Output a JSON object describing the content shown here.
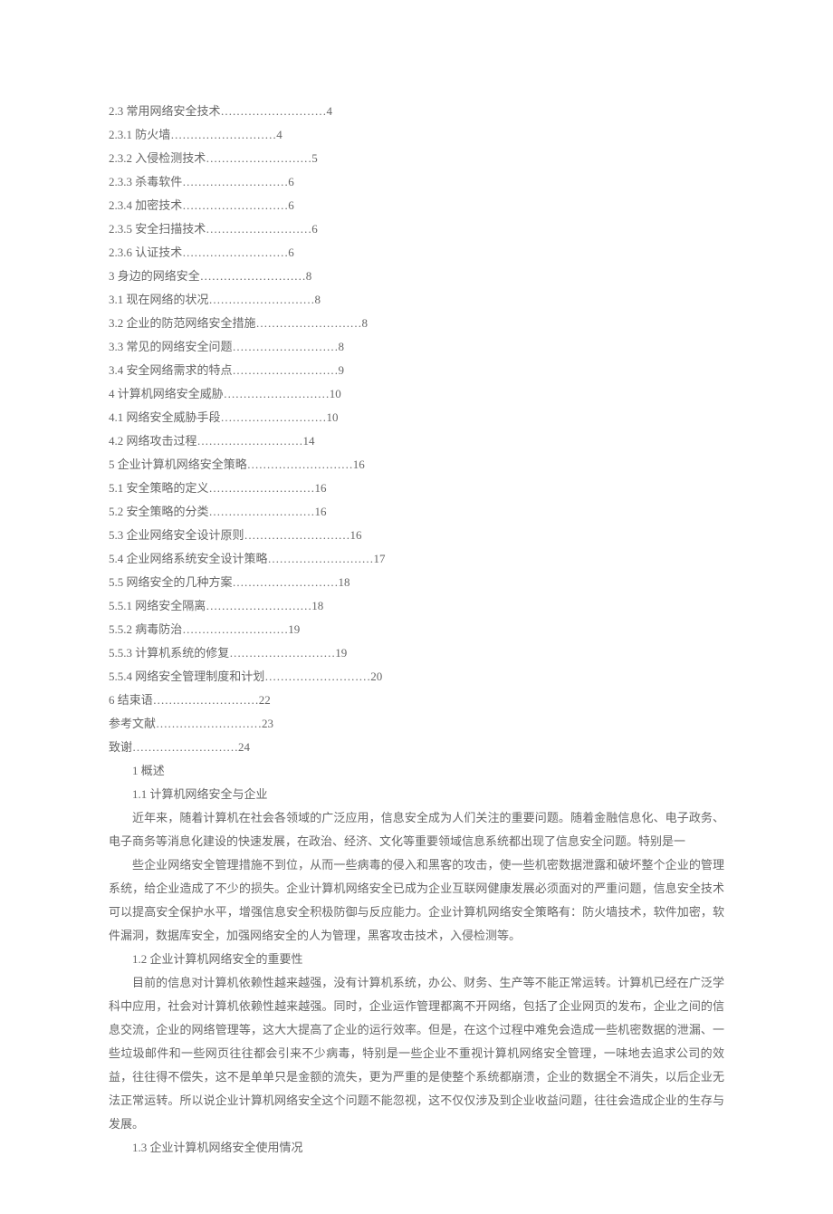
{
  "toc": [
    "2.3 常用网络安全技术………………………4",
    "2.3.1 防火墙………………………4",
    "2.3.2  入侵检测技术………………………5",
    "2.3.3 杀毒软件………………………6",
    "2.3.4 加密技术………………………6",
    "2.3.5 安全扫描技术………………………6",
    "2.3.6 认证技术………………………6",
    "3 身边的网络安全………………………8",
    "3.1 现在网络的状况………………………8",
    "3.2 企业的防范网络安全措施………………………8",
    "3.3 常见的网络安全问题………………………8",
    "3.4  安全网络需求的特点………………………9",
    "4  计算机网络安全威胁………………………10",
    "4.1  网络安全威胁手段………………………10",
    "4.2  网络攻击过程………………………14",
    "5  企业计算机网络安全策略………………………16",
    "5.1  安全策略的定义………………………16",
    "5.2 安全策略的分类………………………16",
    "5.3 企业网络安全设计原则………………………16",
    "5.4 企业网络系统安全设计策略………………………17",
    "5.5 网络安全的几种方案………………………18",
    "5.5.1 网络安全隔离………………………18",
    "5.5.2  病毒防治………………………19",
    "5.5.3  计算机系统的修复………………………19",
    "5.5.4  网络安全管理制度和计划………………………20",
    "6  结束语………………………22",
    "参考文献………………………23",
    "致谢………………………24"
  ],
  "h1": "1  概述",
  "h11": "1.1 计算机网络安全与企业",
  "p11a": "近年来，随着计算机在社会各领域的广泛应用，信息安全成为人们关注的重要问题。随着金融信息化、电子政务、电子商务等消息化建设的快速发展，在政治、经济、文化等重要领域信息系统都出现了信息安全问题。特别是一",
  "p11b": "些企业网络安全管理措施不到位，从而一些病毒的侵入和黑客的攻击，使一些机密数据泄露和破坏整个企业的管理系统，给企业造成了不少的损失。企业计算机网络安全已成为企业互联网健康发展必须面对的严重问题，信息安全技术可以提高安全保护水平，增强信息安全积极防御与反应能力。企业计算机网络安全策略有：防火墙技术，软件加密，软件漏洞，数据库安全，加强网络安全的人为管理，黑客攻击技术，入侵检测等。",
  "h12": "1.2 企业计算机网络安全的重要性",
  "p12": "目前的信息对计算机依赖性越来越强，没有计算机系统，办公、财务、生产等不能正常运转。计算机已经在广泛学科中应用，社会对计算机依赖性越来越强。同时，企业运作管理都离不开网络，包括了企业网页的发布，企业之间的信息交流，企业的网络管理等，这大大提高了企业的运行效率。但是，在这个过程中难免会造成一些机密数据的泄漏、一些垃圾邮件和一些网页往往都会引来不少病毒，特别是一些企业不重视计算机网络安全管理，一味地去追求公司的效益，往往得不偿失，这不是单单只是金额的流失，更为严重的是使整个系统都崩溃，企业的数据全不消失，以后企业无法正常运转。所以说企业计算机网络安全这个问题不能忽视，这不仅仅涉及到企业收益问题，往往会造成企业的生存与发展。",
  "h13": "1.3 企业计算机网络安全使用情况"
}
